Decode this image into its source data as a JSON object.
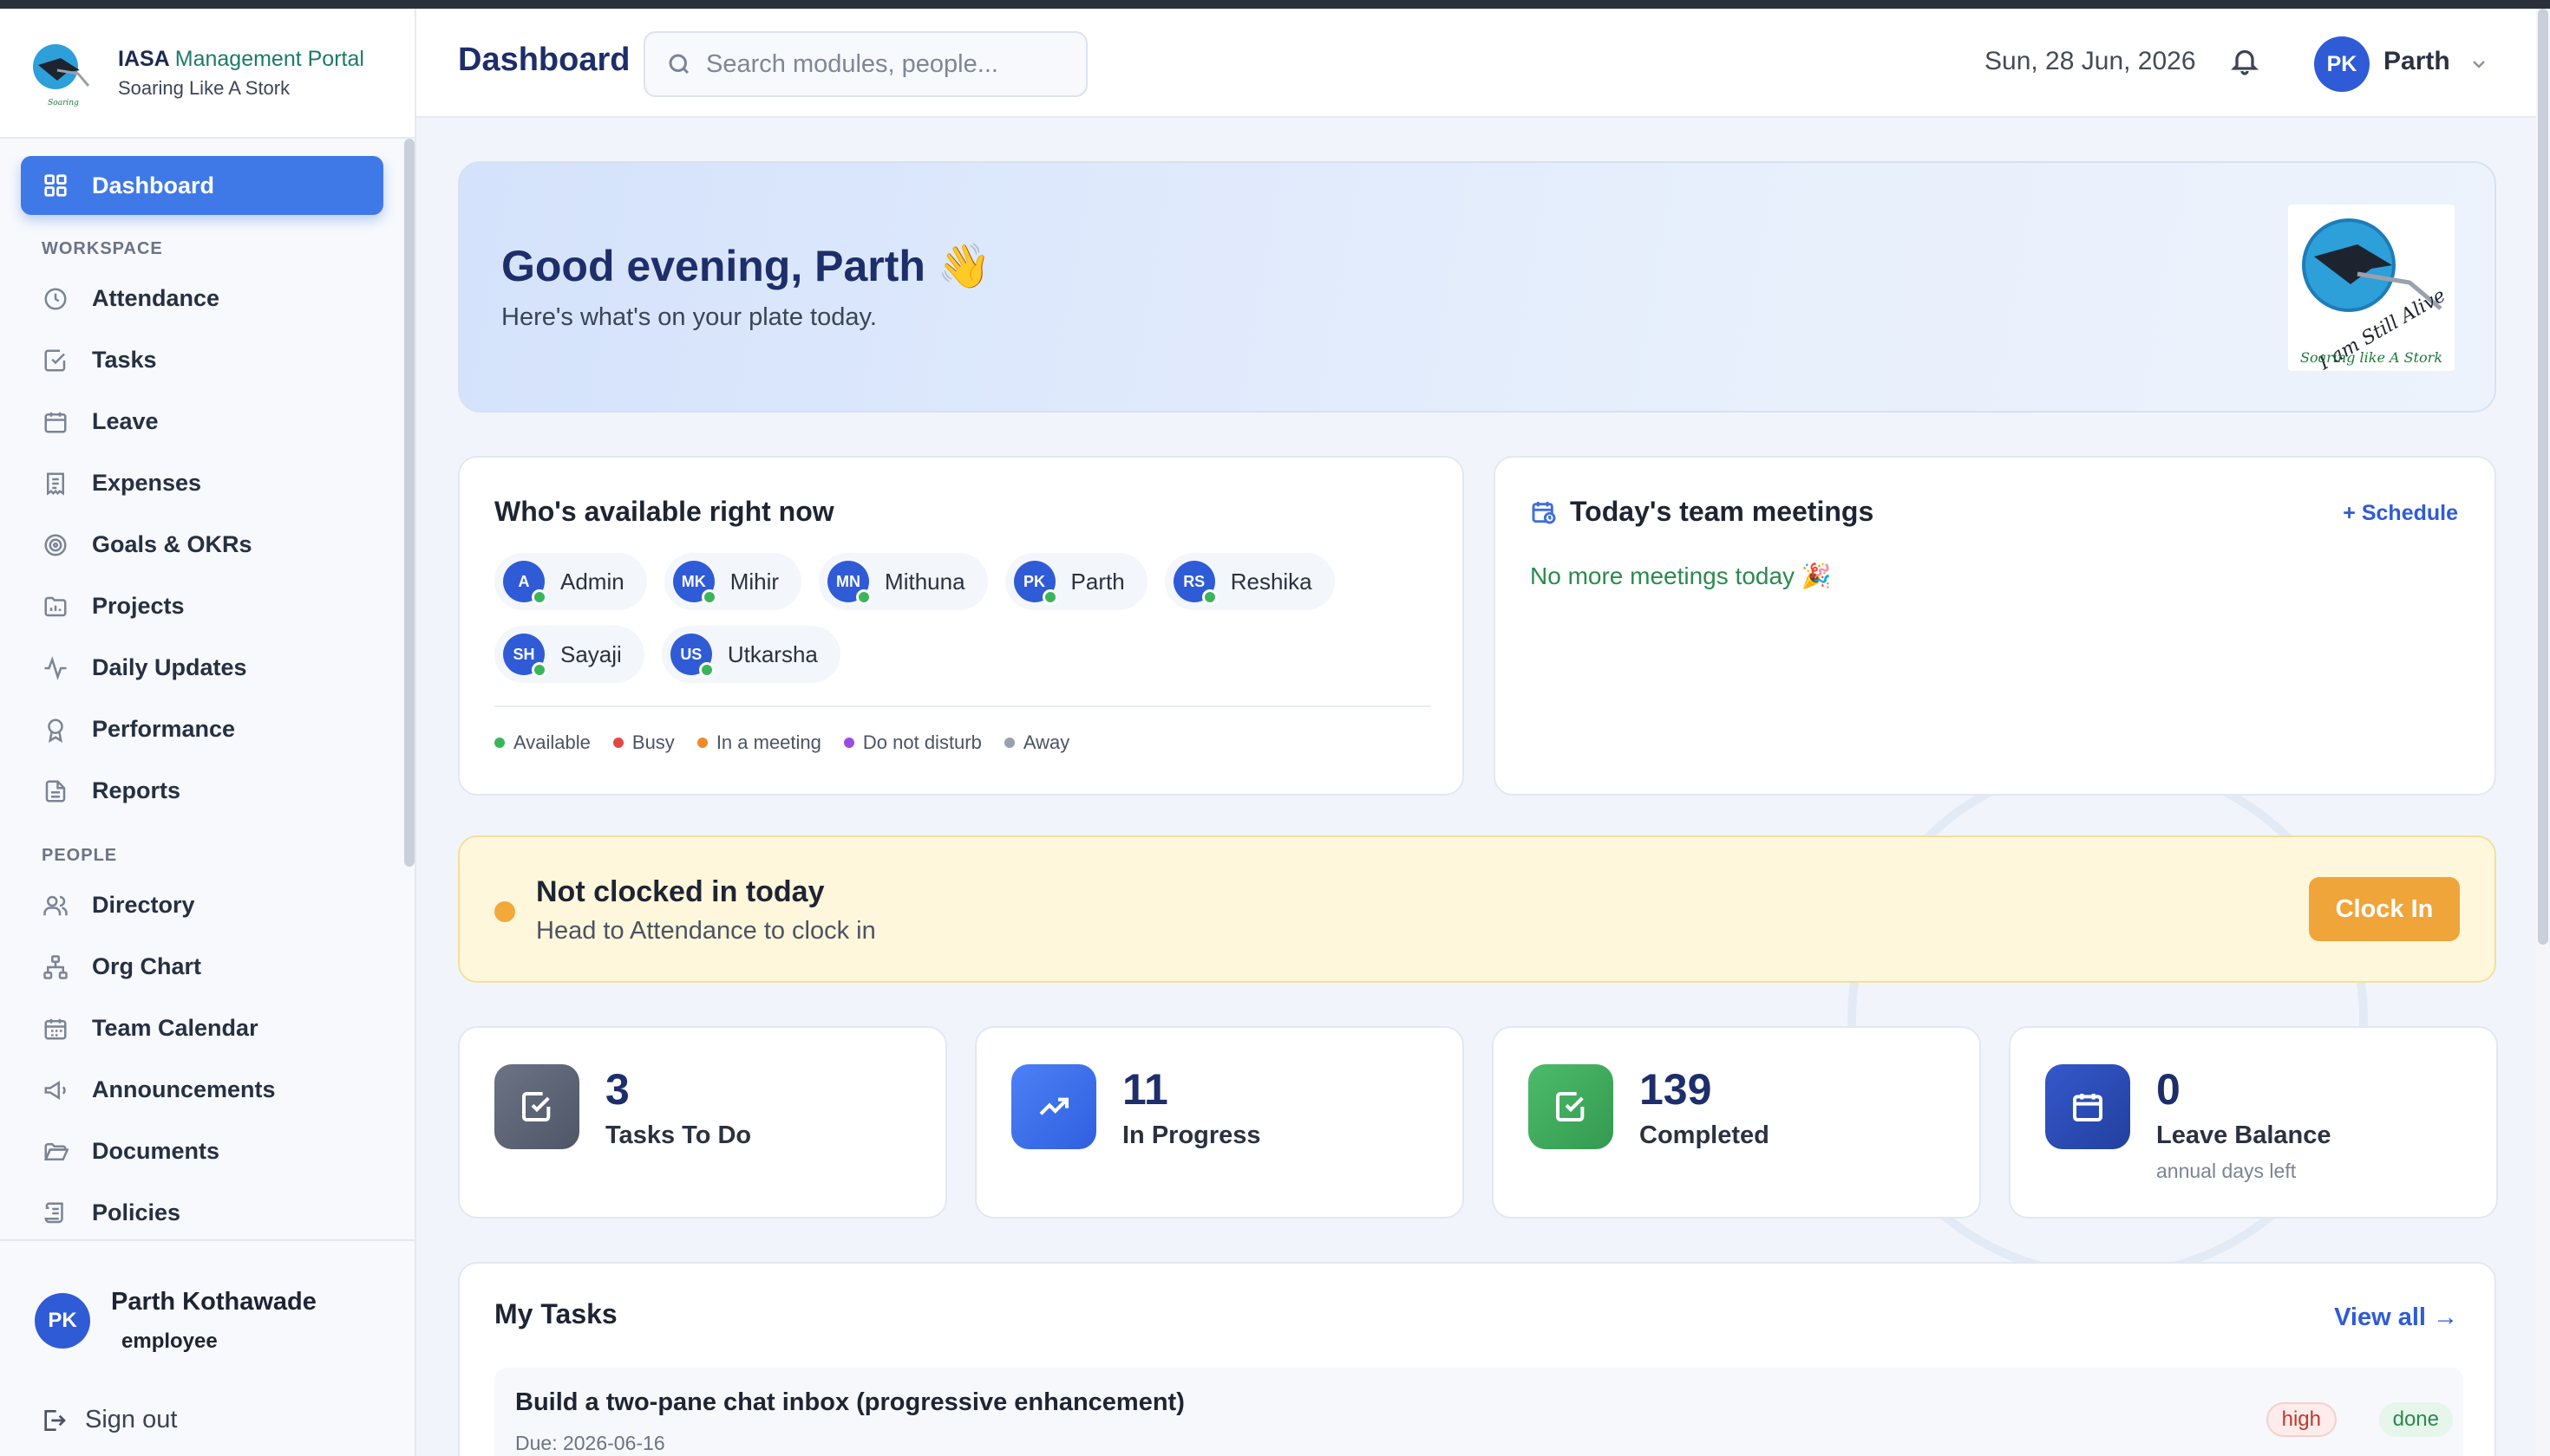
{
  "brand": {
    "title_main": "IASA",
    "title_accent": "Management Portal",
    "subtitle": "Soaring Like A Stork"
  },
  "sidebar": {
    "active": {
      "label": "Dashboard",
      "icon": "grid-icon"
    },
    "sections": [
      {
        "title": "WORKSPACE",
        "items": [
          {
            "label": "Attendance",
            "icon": "clock-icon"
          },
          {
            "label": "Tasks",
            "icon": "check-square-icon"
          },
          {
            "label": "Leave",
            "icon": "calendar-icon"
          },
          {
            "label": "Expenses",
            "icon": "receipt-icon"
          },
          {
            "label": "Goals & OKRs",
            "icon": "target-icon"
          },
          {
            "label": "Projects",
            "icon": "chart-folder-icon"
          },
          {
            "label": "Daily Updates",
            "icon": "activity-icon"
          },
          {
            "label": "Performance",
            "icon": "award-icon"
          },
          {
            "label": "Reports",
            "icon": "file-text-icon"
          }
        ]
      },
      {
        "title": "PEOPLE",
        "items": [
          {
            "label": "Directory",
            "icon": "users-icon"
          },
          {
            "label": "Org Chart",
            "icon": "org-chart-icon"
          },
          {
            "label": "Team Calendar",
            "icon": "calendar-grid-icon"
          },
          {
            "label": "Announcements",
            "icon": "megaphone-icon"
          },
          {
            "label": "Documents",
            "icon": "folder-open-icon"
          },
          {
            "label": "Policies",
            "icon": "scroll-icon"
          }
        ]
      }
    ],
    "user": {
      "initials": "PK",
      "name": "Parth Kothawade",
      "role": "employee"
    },
    "signout": "Sign out"
  },
  "header": {
    "title": "Dashboard",
    "search_placeholder": "Search modules, people...",
    "date": "Sun, 28 Jun, 2026",
    "user_initials": "PK",
    "user_name": "Parth"
  },
  "hero": {
    "greeting": "Good evening, Parth 👋",
    "subtitle": "Here's what's on your plate today."
  },
  "availability": {
    "title": "Who's available right now",
    "people": [
      {
        "initials": "A",
        "name": "Admin"
      },
      {
        "initials": "MK",
        "name": "Mihir"
      },
      {
        "initials": "MN",
        "name": "Mithuna"
      },
      {
        "initials": "PK",
        "name": "Parth"
      },
      {
        "initials": "RS",
        "name": "Reshika"
      },
      {
        "initials": "SH",
        "name": "Sayaji"
      },
      {
        "initials": "US",
        "name": "Utkarsha"
      }
    ],
    "legend": [
      {
        "label": "Available",
        "color": "#3bb55c"
      },
      {
        "label": "Busy",
        "color": "#e04848"
      },
      {
        "label": "In a meeting",
        "color": "#f08a2a"
      },
      {
        "label": "Do not disturb",
        "color": "#9b4de0"
      },
      {
        "label": "Away",
        "color": "#9aa1ad"
      }
    ]
  },
  "meetings": {
    "title": "Today's team meetings",
    "schedule_label": "+ Schedule",
    "empty_text": "No more meetings today 🎉"
  },
  "clock": {
    "title": "Not clocked in today",
    "subtitle": "Head to Attendance to clock in",
    "button": "Clock In"
  },
  "stats": [
    {
      "value": "3",
      "label": "Tasks To Do",
      "note": "",
      "icon": "check-square-icon",
      "color": "#5e6677"
    },
    {
      "value": "11",
      "label": "In Progress",
      "note": "",
      "icon": "trending-up-icon",
      "color": "#3b6ff0"
    },
    {
      "value": "139",
      "label": "Completed",
      "note": "",
      "icon": "check-square-icon",
      "color": "#3fae5c"
    },
    {
      "value": "0",
      "label": "Leave Balance",
      "note": "annual days left",
      "icon": "calendar-icon",
      "color": "#2a4fbf"
    }
  ],
  "tasks": {
    "title": "My Tasks",
    "view_all": "View all →",
    "items": [
      {
        "title": "Build a two-pane chat inbox (progressive enhancement)",
        "due": "Due: 2026-06-16",
        "priority": "high",
        "status": "done"
      }
    ]
  }
}
